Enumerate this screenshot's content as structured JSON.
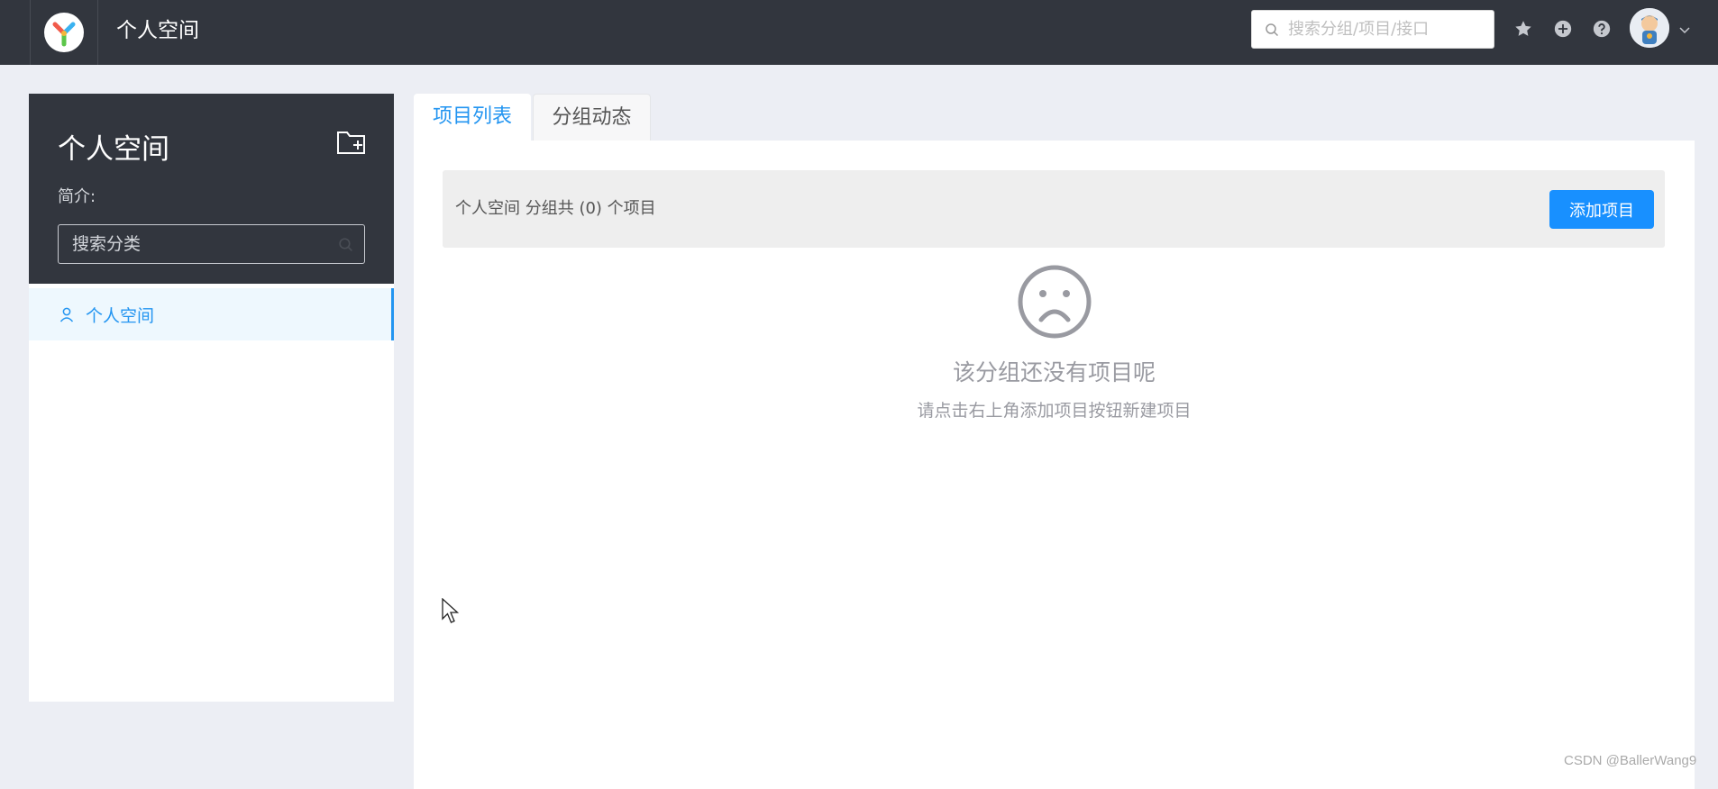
{
  "header": {
    "app_title": "个人空间",
    "logo_icon": "yapi-logo-icon",
    "search_placeholder": "搜索分组/项目/接口",
    "icons": [
      "search-icon",
      "star-icon",
      "plus-circle-icon",
      "question-circle-icon",
      "chevron-down-icon"
    ]
  },
  "sidebar": {
    "title": "个人空间",
    "desc_label": "简介:",
    "search_placeholder": "搜索分类",
    "items": [
      {
        "label": "个人空间",
        "icon": "user-icon",
        "active": true
      }
    ]
  },
  "tabs": [
    {
      "label": "项目列表",
      "active": true
    },
    {
      "label": "分组动态",
      "active": false
    }
  ],
  "main": {
    "count_text": "个人空间 分组共 (0) 个项目",
    "add_button": "添加项目",
    "empty_icon": "frown-icon",
    "empty_title": "该分组还没有项目呢",
    "empty_desc": "请点击右上角添加项目按钮新建项目"
  },
  "watermark": "CSDN @BallerWang9",
  "colors": {
    "topbar": "#32363e",
    "accent": "#2395f1",
    "button": "#1890ff",
    "page_bg": "#eceef4"
  }
}
